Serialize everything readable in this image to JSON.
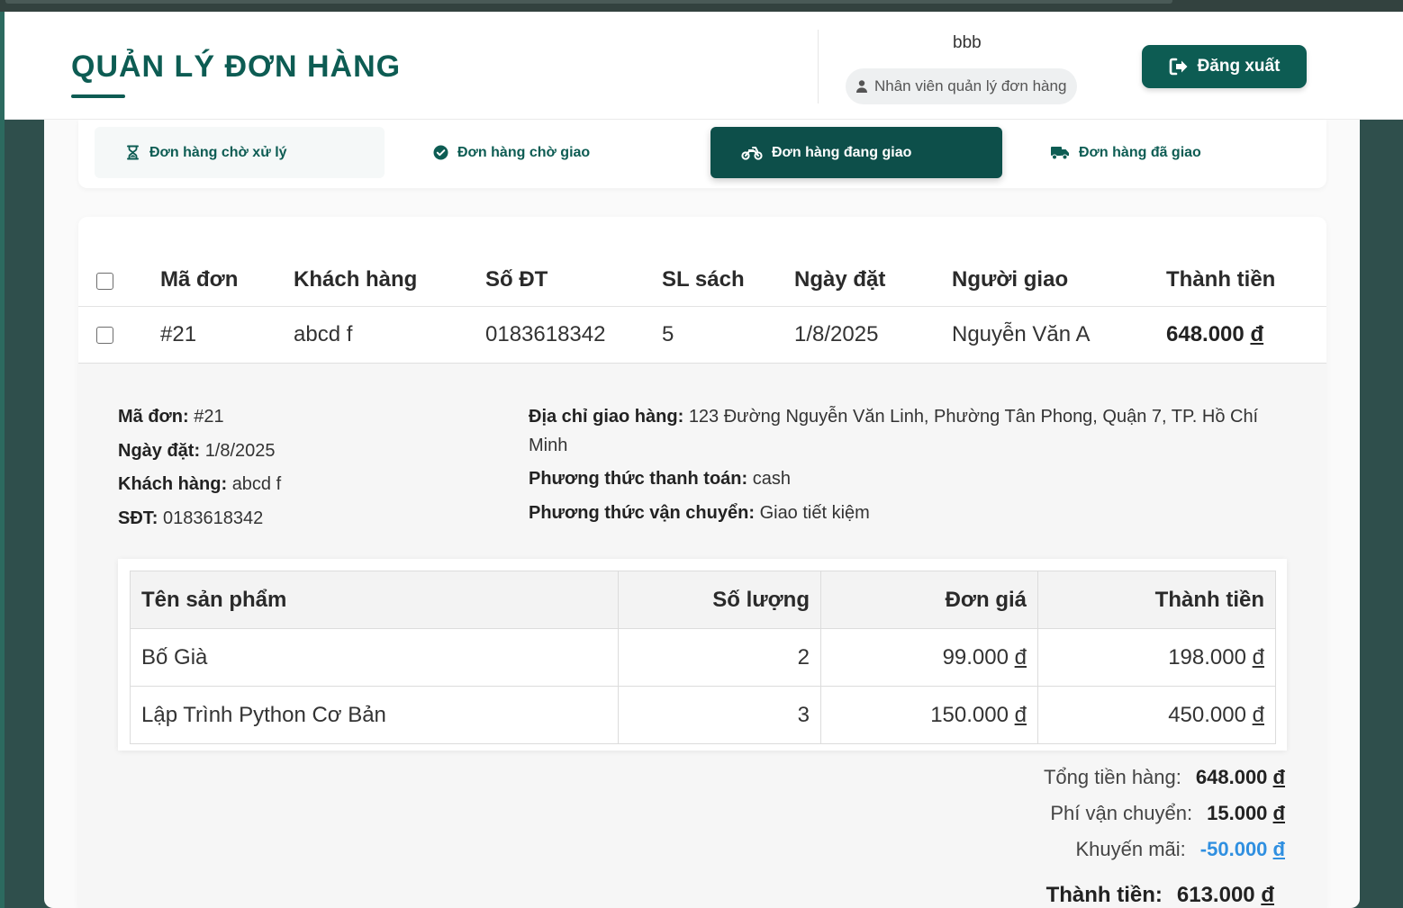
{
  "header": {
    "title": "QUẢN LÝ ĐƠN HÀNG",
    "username": "bbb",
    "role": "Nhân viên quản lý đơn hàng",
    "logout_label": "Đăng xuất"
  },
  "tabs": [
    {
      "label": "Đơn hàng chờ xử lý",
      "icon": "hourglass-icon",
      "active": false
    },
    {
      "label": "Đơn hàng chờ giao",
      "icon": "check-circle-icon",
      "active": false
    },
    {
      "label": "Đơn hàng đang giao",
      "icon": "motorcycle-icon",
      "active": true
    },
    {
      "label": "Đơn hàng đã giao",
      "icon": "truck-icon",
      "active": false
    }
  ],
  "orders": {
    "headers": [
      "Mã đơn",
      "Khách hàng",
      "Số ĐT",
      "SL sách",
      "Ngày đặt",
      "Người giao",
      "Thành tiền"
    ],
    "rows": [
      {
        "code": "#21",
        "customer": "abcd f",
        "phone": "0183618342",
        "qty": "5",
        "date": "1/8/2025",
        "shipper": "Nguyễn Văn A",
        "total": "648.000",
        "currency": "đ"
      }
    ]
  },
  "detail": {
    "code_label": "Mã đơn:",
    "code": "#21",
    "date_label": "Ngày đặt:",
    "date": "1/8/2025",
    "customer_label": "Khách hàng:",
    "customer": "abcd f",
    "phone_label": "SĐT:",
    "phone": "0183618342",
    "address_label": "Địa chỉ giao hàng:",
    "address": "123 Đường Nguyễn Văn Linh, Phường Tân Phong, Quận 7, TP. Hồ Chí Minh",
    "payment_label": "Phương thức thanh toán:",
    "payment": "cash",
    "shipping_label": "Phương thức vận chuyển:",
    "shipping": "Giao tiết kiệm",
    "items": {
      "headers": [
        "Tên sản phẩm",
        "Số lượng",
        "Đơn giá",
        "Thành tiền"
      ],
      "rows": [
        {
          "name": "Bố Già",
          "qty": "2",
          "price": "99.000",
          "total": "198.000"
        },
        {
          "name": "Lập Trình Python Cơ Bản",
          "qty": "3",
          "price": "150.000",
          "total": "450.000"
        }
      ]
    },
    "summary": {
      "subtotal_label": "Tổng tiền hàng:",
      "subtotal": "648.000",
      "shipping_fee_label": "Phí vận chuyển:",
      "shipping_fee": "15.000",
      "discount_label": "Khuyến mãi:",
      "discount": "-50.000",
      "grand_total_label": "Thành tiền:",
      "grand_total": "613.000",
      "currency": "đ"
    }
  },
  "colors": {
    "primary": "#0d5c53",
    "active_tab": "#0d4f4a",
    "discount": "#2f8fe0"
  }
}
